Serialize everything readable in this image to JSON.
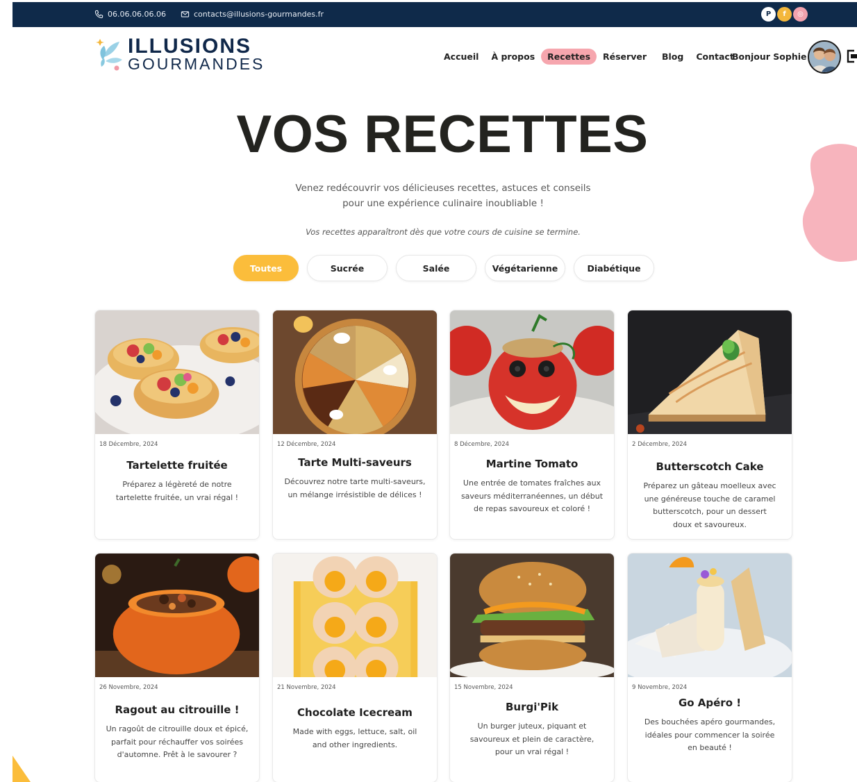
{
  "topbar": {
    "phone": "06.06.06.06.06",
    "email": "contacts@illusions-gourmandes.fr",
    "social": [
      {
        "name": "pinterest-icon",
        "glyph": "P",
        "color": "#ffffff"
      },
      {
        "name": "facebook-icon",
        "glyph": "f",
        "color": "#f4b73b"
      },
      {
        "name": "instagram-icon",
        "glyph": "◎",
        "color": "#f3a2ad"
      }
    ]
  },
  "brand": {
    "line1": "ILLUSIONS",
    "line2": "GOURMANDES"
  },
  "nav": {
    "items": [
      "Accueil",
      "À propos",
      "Recettes",
      "Réserver",
      "Blog",
      "Contact"
    ],
    "active": "Recettes"
  },
  "user": {
    "greeting": "Bonjour Sophie !"
  },
  "hero": {
    "title": "VOS RECETTES",
    "subtitle": "Venez redécouvrir vos délicieuses recettes, astuces et conseils pour une expérience culinaire inoubliable !",
    "note": "Vos recettes apparaîtront dès que votre cours de cuisine se termine."
  },
  "filters": {
    "items": [
      "Toutes",
      "Sucrée",
      "Salée",
      "Végétarienne",
      "Diabétique"
    ],
    "active": "Toutes"
  },
  "recipes": [
    {
      "date": "18 Décembre, 2024",
      "title": "Tartelette fruitée",
      "description": "Préparez a légèreté de notre tartelette fruitée, un vrai régal !",
      "image": "fruit-tartlets"
    },
    {
      "date": "12 Décembre, 2024",
      "title": "Tarte Multi-saveurs",
      "description": "Découvrez notre tarte multi-saveurs, un mélange irrésistible de délices !",
      "image": "multi-flavor-pie"
    },
    {
      "date": "8 Décembre, 2024",
      "title": "Martine Tomato",
      "description": "Une entrée de tomates fraîches aux saveurs méditerranéennes, un début de repas savoureux et coloré !",
      "image": "stuffed-tomato-face"
    },
    {
      "date": "2 Décembre, 2024",
      "title": "Butterscotch Cake",
      "description": "Préparez un gâteau moelleux avec une généreuse touche de caramel butterscotch, pour un dessert doux et savoureux.",
      "image": "butterscotch-cake-slice"
    },
    {
      "date": "26 Novembre, 2024",
      "title": "Ragout au citrouille !",
      "description": "Un ragoût de citrouille doux et épicé, parfait pour réchauffer vos soirées d'automne. Prêt à le savourer ?",
      "image": "pumpkin-stew"
    },
    {
      "date": "21 Novembre, 2024",
      "title": "Chocolate Icecream",
      "description": "Made with eggs, lettuce, salt, oil and other ingredients.",
      "image": "egg-cookies"
    },
    {
      "date": "15 Novembre, 2024",
      "title": "Burgi'Pik",
      "description": "Un burger juteux, piquant et savoureux et plein de caractère, pour un vrai régal !",
      "image": "burger"
    },
    {
      "date": "9 Novembre, 2024",
      "title": "Go Apéro !",
      "description": "Des bouchées apéro gourmandes, idéales pour commencer la soirée en beauté !",
      "image": "aperitif-bites"
    }
  ],
  "colors": {
    "topbar": "#0f2a4a",
    "accent_yellow": "#fbbd3b",
    "accent_pink": "#f6a6ae",
    "title": "#23231f"
  }
}
